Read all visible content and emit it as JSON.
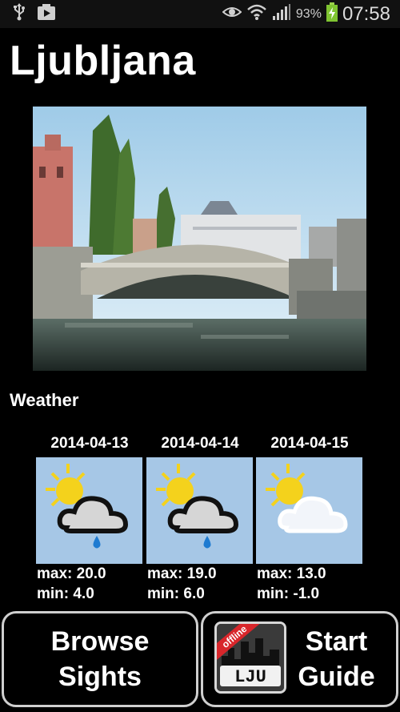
{
  "status_bar": {
    "battery": "93%",
    "time": "07:58"
  },
  "city": {
    "name": "Ljubljana"
  },
  "weather": {
    "title": "Weather",
    "days": [
      {
        "date": "2014-04-13",
        "condition": "cloud-rain-icon",
        "max": "max: 20.0",
        "min": "min: 4.0"
      },
      {
        "date": "2014-04-14",
        "condition": "cloud-rain-icon",
        "max": "max: 19.0",
        "min": "min: 6.0"
      },
      {
        "date": "2014-04-15",
        "condition": "sun-cloud-icon",
        "max": "max: 13.0",
        "min": "min: -1.0"
      }
    ]
  },
  "buttons": {
    "browse_line1": "Browse",
    "browse_line2": "Sights",
    "start_line1": "Start",
    "start_line2": "Guide",
    "badge_ribbon": "offline",
    "badge_code": "LJU"
  },
  "colors": {
    "background": "#000000",
    "icon_tile": "#a6c7e6"
  }
}
